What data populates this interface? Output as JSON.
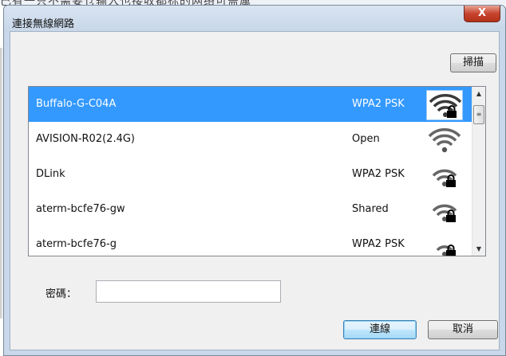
{
  "background": {
    "partial_text": "己有一只不需要仓输入也接收都标的网络可盖属"
  },
  "window": {
    "title": "連接無線網路",
    "close_label": "X"
  },
  "toolbar": {
    "scan_label": "掃描"
  },
  "networks": [
    {
      "ssid": "Buffalo-G-C04A",
      "security": "WPA2 PSK",
      "icon": "wifi-lock-icon",
      "selected": true
    },
    {
      "ssid": "AVISION-R02(2.4G)",
      "security": "Open",
      "icon": "wifi-icon",
      "selected": false
    },
    {
      "ssid": "DLink",
      "security": "WPA2 PSK",
      "icon": "wifi-lock-icon",
      "selected": false
    },
    {
      "ssid": "aterm-bcfe76-gw",
      "security": "Shared",
      "icon": "wifi-lock-icon",
      "selected": false
    },
    {
      "ssid": "aterm-bcfe76-g",
      "security": "WPA2 PSK",
      "icon": "wifi-lock-icon",
      "selected": false
    }
  ],
  "scrollbar": {
    "up_icon": "scroll-up-arrow-icon",
    "down_icon": "scroll-down-arrow-icon"
  },
  "password": {
    "label": "密碼：",
    "value": "",
    "placeholder": ""
  },
  "actions": {
    "connect_label": "連線",
    "cancel_label": "取消"
  },
  "colors": {
    "selection": "#3399ff",
    "close_button": "#c7442e",
    "default_button_border": "#3c7fb1"
  }
}
